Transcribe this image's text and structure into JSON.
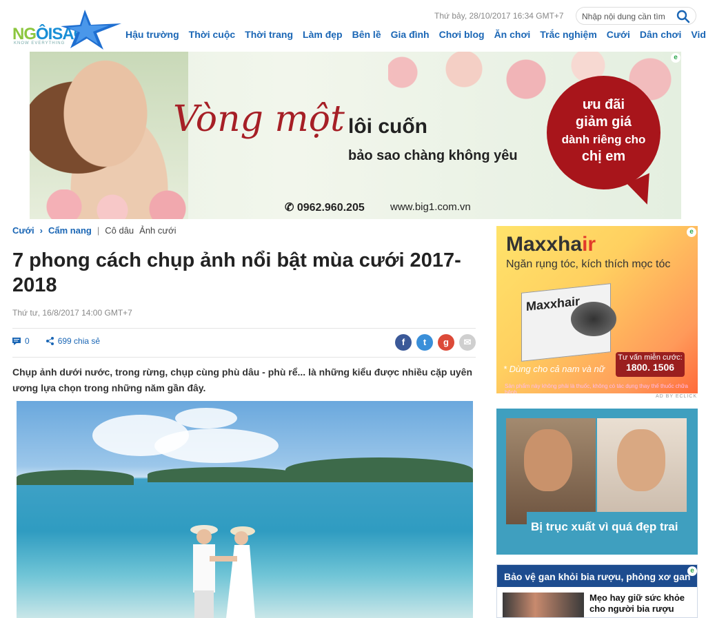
{
  "header": {
    "date": "Thứ bảy, 28/10/2017 16:34 GMT+7",
    "search_placeholder": "Nhập nội dung cần tìm",
    "logo_text_a": "NG",
    "logo_text_b": "ÔISAO",
    "logo_tagline": "KNOW EVERYTHING",
    "nav": [
      "Hậu trường",
      "Thời cuộc",
      "Thời trang",
      "Làm đẹp",
      "Bên lề",
      "Gia đình",
      "Chơi blog",
      "Ăn chơi",
      "Trắc nghiệm",
      "Cưới",
      "Dân chơi",
      "Video"
    ]
  },
  "banner": {
    "script": "Vòng một",
    "headline": "lôi cuốn",
    "subline": "bảo sao chàng không yêu",
    "promo": [
      "ưu đãi",
      "giảm giá",
      "dành riêng cho",
      "chị em"
    ],
    "phone": "0962.960.205",
    "website": "www.big1.com.vn"
  },
  "breadcrumb": {
    "section": "Cưới",
    "sub": "Cẩm nang",
    "tags": [
      "Cô dâu",
      "Ảnh cưới"
    ]
  },
  "article": {
    "title": "7 phong cách chụp ảnh nổi bật mùa cưới 2017-2018",
    "date": "Thứ tư, 16/8/2017 14:00 GMT+7",
    "comments": "0",
    "shares": "699 chia sẻ",
    "lead": "Chụp ảnh dưới nước, trong rừng, chụp cùng phù dâu - phù rể... là những kiểu được nhiều cặp uyên ương lựa chọn trong những năm gần đây."
  },
  "sidebar": {
    "ad1": {
      "brand_a": "Maxxha",
      "brand_b": "ir",
      "tagline": "Ngăn rụng tóc, kích thích mọc tóc",
      "box_name": "Maxxhair",
      "note": "* Dùng cho cả nam và nữ",
      "hotline_label": "Tư vấn miễn cước:",
      "hotline": "1800. 1506",
      "fine_print": "Sản phẩm này không phải là thuốc, không có tác dụng thay thế thuốc chữa bệnh",
      "ad_by": "AD BY ECLICK"
    },
    "ad2": {
      "caption": "Bị trục xuất vì quá đẹp trai"
    },
    "ad3": {
      "header": "Bảo vệ gan khỏi bia rượu, phòng xơ gan",
      "item": "Mẹo hay giữ sức khỏe cho người bia rượu"
    }
  },
  "colors": {
    "nav_blue": "#1a66b5",
    "promo_red": "#a8151b",
    "logo_green": "#8cc63f"
  }
}
